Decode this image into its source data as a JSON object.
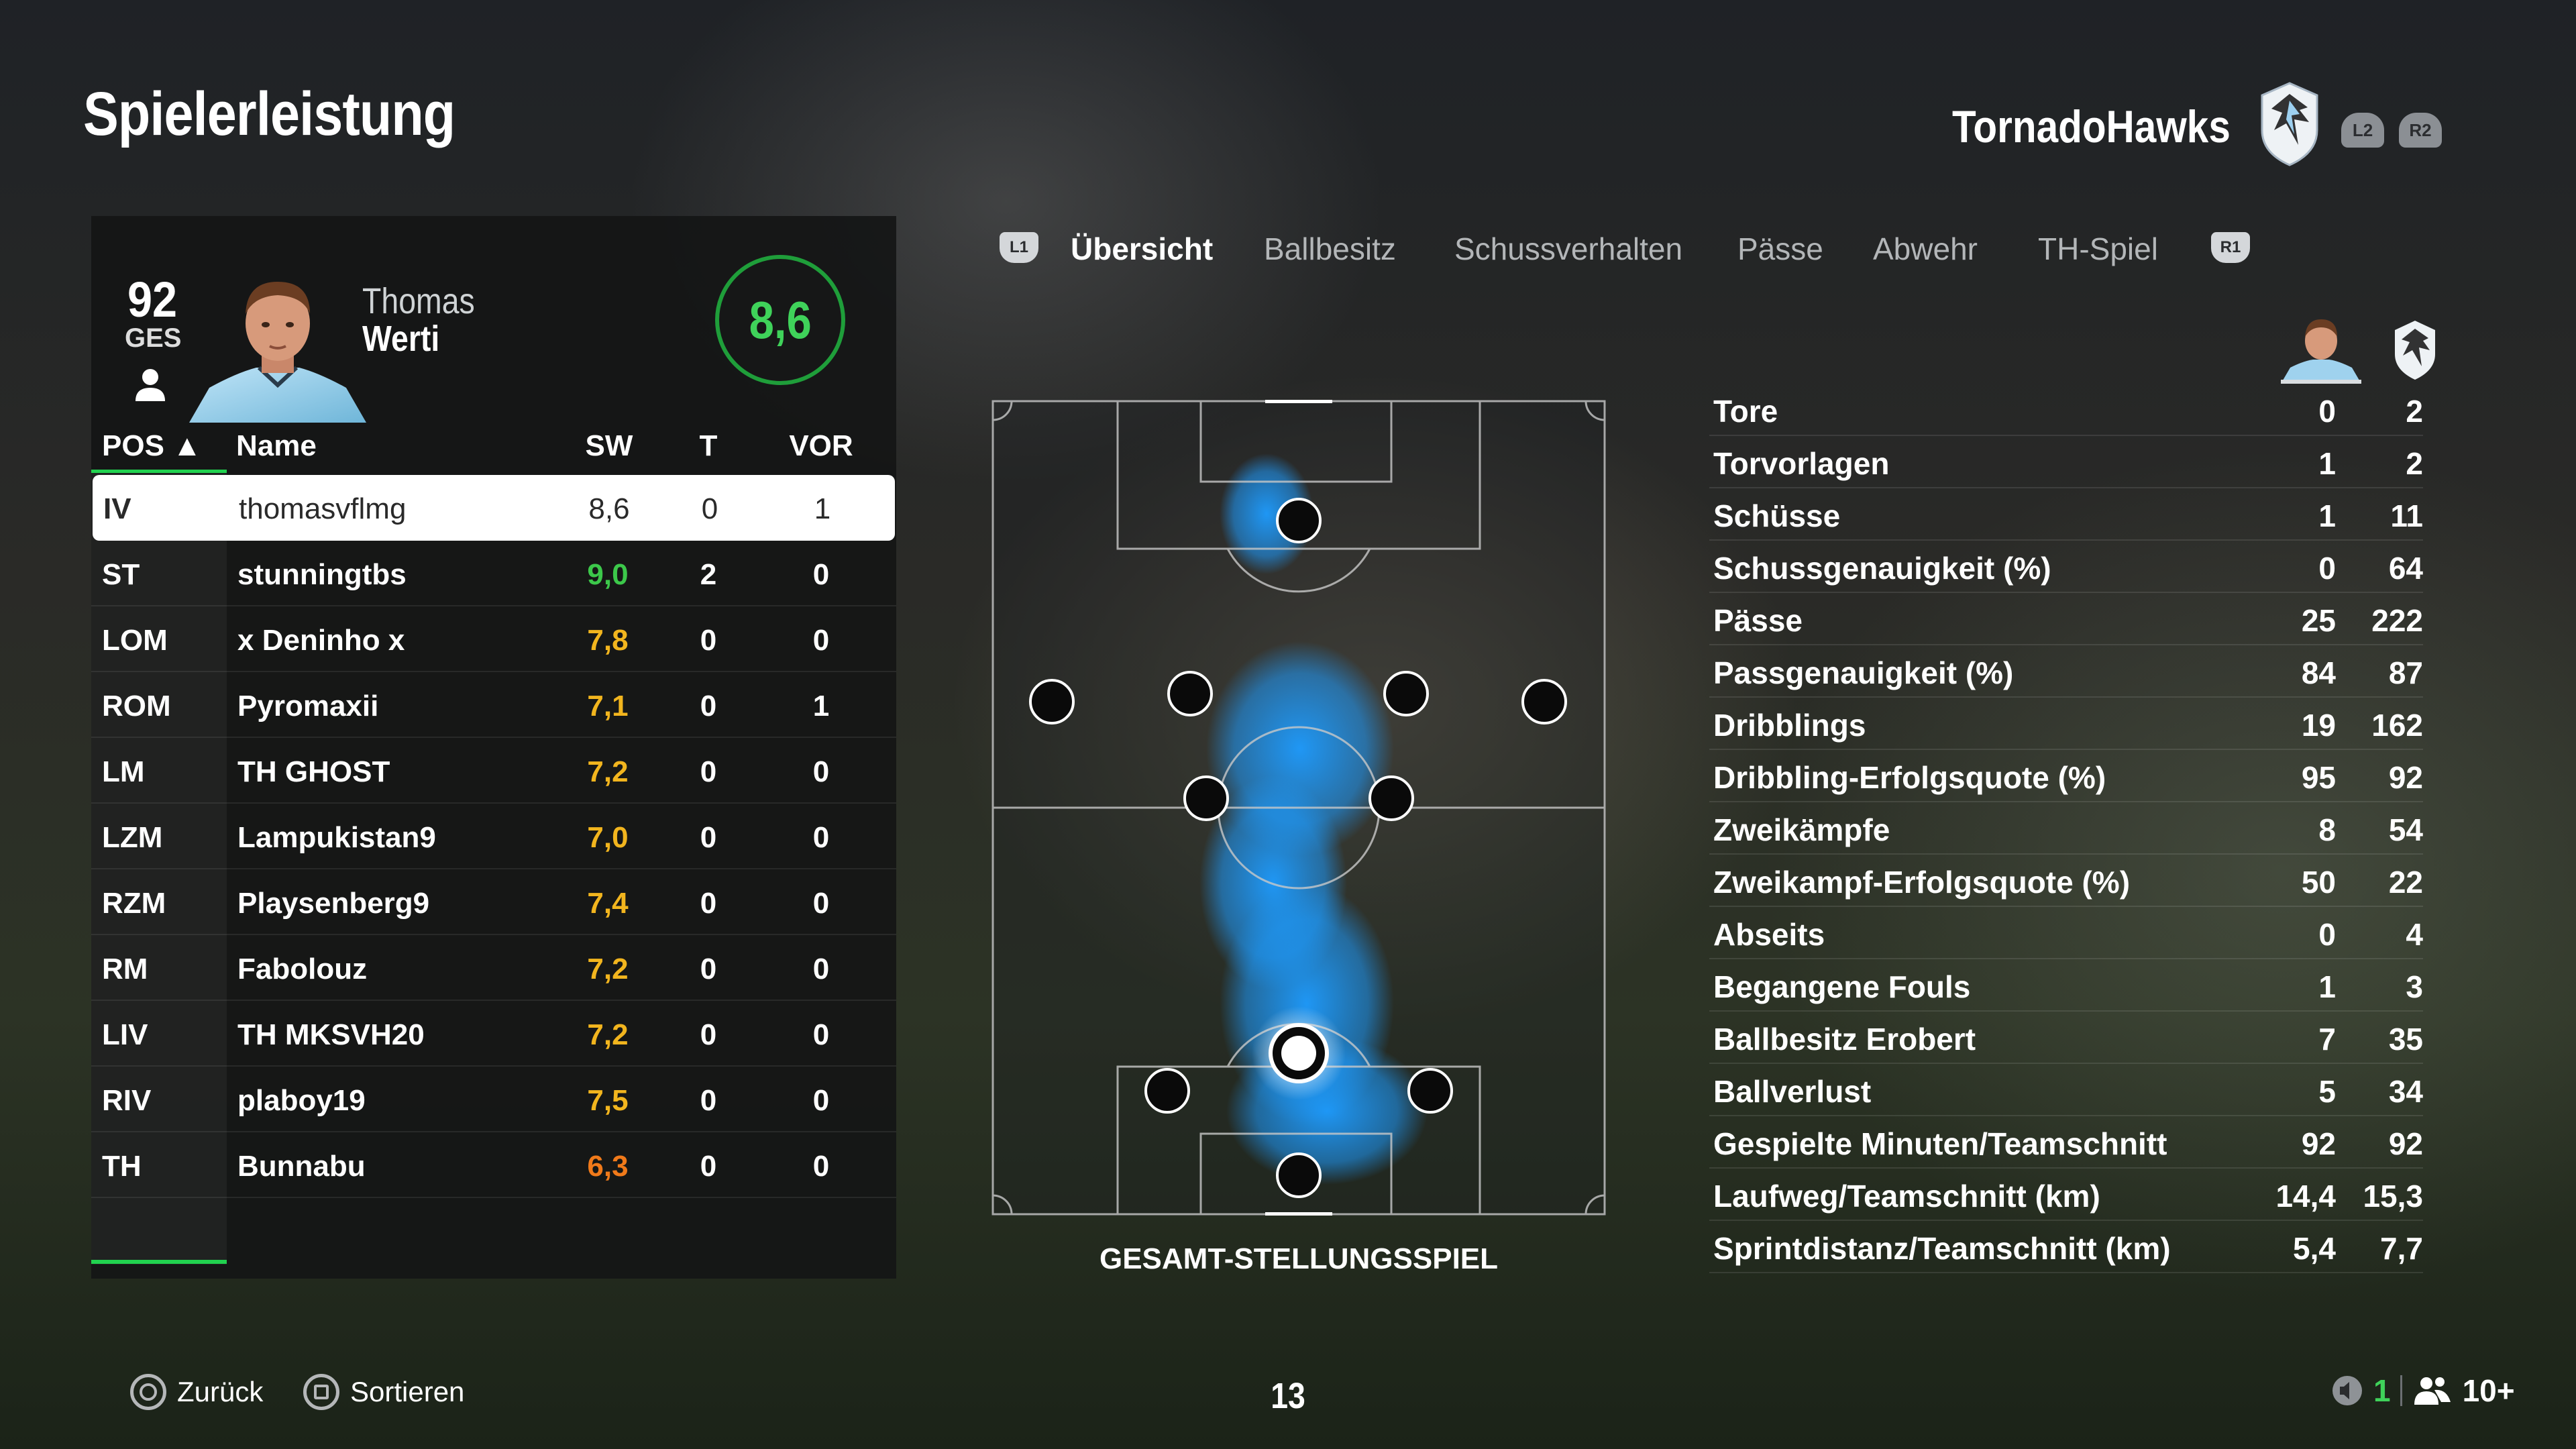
{
  "header": {
    "title": "Spielerleistung",
    "team_name": "TornadoHawks",
    "btn_l2": "L2",
    "btn_r2": "R2"
  },
  "player_card": {
    "overall": "92",
    "overall_label": "GES",
    "first_name": "Thomas",
    "last_name": "Werti",
    "match_rating": "8,6"
  },
  "table": {
    "headers": {
      "pos": "POS ▲",
      "name": "Name",
      "sw": "SW",
      "t": "T",
      "vor": "VOR"
    },
    "rows": [
      {
        "pos": "IV",
        "name": "thomasvflmg",
        "sw": "8,6",
        "sw_color": "#2a2a2a",
        "t": "0",
        "vor": "1",
        "selected": true
      },
      {
        "pos": "ST",
        "name": "stunningtbs",
        "sw": "9,0",
        "sw_color": "#3cc84a",
        "t": "2",
        "vor": "0"
      },
      {
        "pos": "LOM",
        "name": "x Deninho x",
        "sw": "7,8",
        "sw_color": "#f2b51e",
        "t": "0",
        "vor": "0"
      },
      {
        "pos": "ROM",
        "name": "Pyromaxii",
        "sw": "7,1",
        "sw_color": "#f2b51e",
        "t": "0",
        "vor": "1"
      },
      {
        "pos": "LM",
        "name": "TH GHOST",
        "sw": "7,2",
        "sw_color": "#f2b51e",
        "t": "0",
        "vor": "0"
      },
      {
        "pos": "LZM",
        "name": "Lampukistan9",
        "sw": "7,0",
        "sw_color": "#f2b51e",
        "t": "0",
        "vor": "0"
      },
      {
        "pos": "RZM",
        "name": "Playsenberg9",
        "sw": "7,4",
        "sw_color": "#f2b51e",
        "t": "0",
        "vor": "0"
      },
      {
        "pos": "RM",
        "name": "Fabolouz",
        "sw": "7,2",
        "sw_color": "#f2b51e",
        "t": "0",
        "vor": "0"
      },
      {
        "pos": "LIV",
        "name": "TH MKSVH20",
        "sw": "7,2",
        "sw_color": "#f2b51e",
        "t": "0",
        "vor": "0"
      },
      {
        "pos": "RIV",
        "name": "plaboy19",
        "sw": "7,5",
        "sw_color": "#f2b51e",
        "t": "0",
        "vor": "0"
      },
      {
        "pos": "TH",
        "name": "Bunnabu",
        "sw": "6,3",
        "sw_color": "#f07a1a",
        "t": "0",
        "vor": "0"
      }
    ]
  },
  "tabs": {
    "btn_l1": "L1",
    "btn_r1": "R1",
    "items": [
      "Übersicht",
      "Ballbesitz",
      "Schussverhalten",
      "Pässe",
      "Abwehr",
      "TH-Spiel"
    ],
    "active": "Übersicht"
  },
  "field": {
    "caption": "GESAMT-STELLUNGSSPIEL"
  },
  "stats": [
    {
      "label": "Tore",
      "player": "0",
      "team": "2"
    },
    {
      "label": "Torvorlagen",
      "player": "1",
      "team": "2"
    },
    {
      "label": "Schüsse",
      "player": "1",
      "team": "11"
    },
    {
      "label": "Schussgenauigkeit (%)",
      "player": "0",
      "team": "64"
    },
    {
      "label": "Pässe",
      "player": "25",
      "team": "222"
    },
    {
      "label": "Passgenauigkeit (%)",
      "player": "84",
      "team": "87"
    },
    {
      "label": "Dribblings",
      "player": "19",
      "team": "162"
    },
    {
      "label": "Dribbling-Erfolgsquote (%)",
      "player": "95",
      "team": "92"
    },
    {
      "label": "Zweikämpfe",
      "player": "8",
      "team": "54"
    },
    {
      "label": "Zweikampf-Erfolgsquote (%)",
      "player": "50",
      "team": "22"
    },
    {
      "label": "Abseits",
      "player": "0",
      "team": "4"
    },
    {
      "label": "Begangene Fouls",
      "player": "1",
      "team": "3"
    },
    {
      "label": "Ballbesitz Erobert",
      "player": "7",
      "team": "35"
    },
    {
      "label": "Ballverlust",
      "player": "5",
      "team": "34"
    },
    {
      "label": "Gespielte Minuten/Teamschnitt",
      "player": "92",
      "team": "92"
    },
    {
      "label": "Laufweg/Teamschnitt (km)",
      "player": "14,4",
      "team": "15,3"
    },
    {
      "label": "Sprintdistanz/Teamschnitt (km)",
      "player": "5,4",
      "team": "7,7"
    }
  ],
  "footer": {
    "back_label": "Zurück",
    "sort_label": "Sortieren",
    "page_number": "13",
    "voice_count": "1",
    "party_count": "10+"
  },
  "colors": {
    "accent_green": "#21d24f",
    "rating_green": "#3fd25a",
    "heatmap_blue": "#1e9cff"
  }
}
